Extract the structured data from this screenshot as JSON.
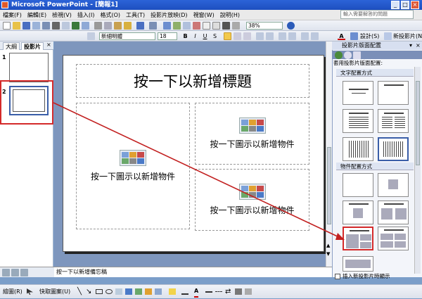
{
  "window": {
    "title": "Microsoft PowerPoint - [簡報1]"
  },
  "menu": {
    "items": [
      "檔案(F)",
      "編輯(E)",
      "檢視(V)",
      "插入(I)",
      "格式(O)",
      "工具(T)",
      "投影片放映(D)",
      "視窗(W)",
      "說明(H)"
    ],
    "help_placeholder": "輸入需要解答的問題"
  },
  "format": {
    "font": "新細明體",
    "size": "18",
    "zoom": "38%",
    "design_label": "設計(S)",
    "new_slide_label": "新投影片(N)"
  },
  "left_pane": {
    "tabs": [
      "大綱",
      "投影片"
    ],
    "slides": [
      "1",
      "2"
    ]
  },
  "slide": {
    "title_placeholder": "按一下以新增標題",
    "content_placeholder": "按一下圖示以新增物件"
  },
  "notes": {
    "placeholder": "按一下以新增備忘稿"
  },
  "task_pane": {
    "title": "投影片版面配置",
    "apply_label": "套用投影片版面配置:",
    "section_text": "文字配置方式",
    "section_content": "物件配置方式",
    "show_on_insert": "插入新投影片時顯示"
  },
  "draw": {
    "draw_label": "繪圖(R)",
    "autoshape_label": "快取圖案(U)"
  },
  "colors": {
    "arrow": "#c22020",
    "highlight": "#d42a2a",
    "titlebar": "#1d4fbf"
  }
}
